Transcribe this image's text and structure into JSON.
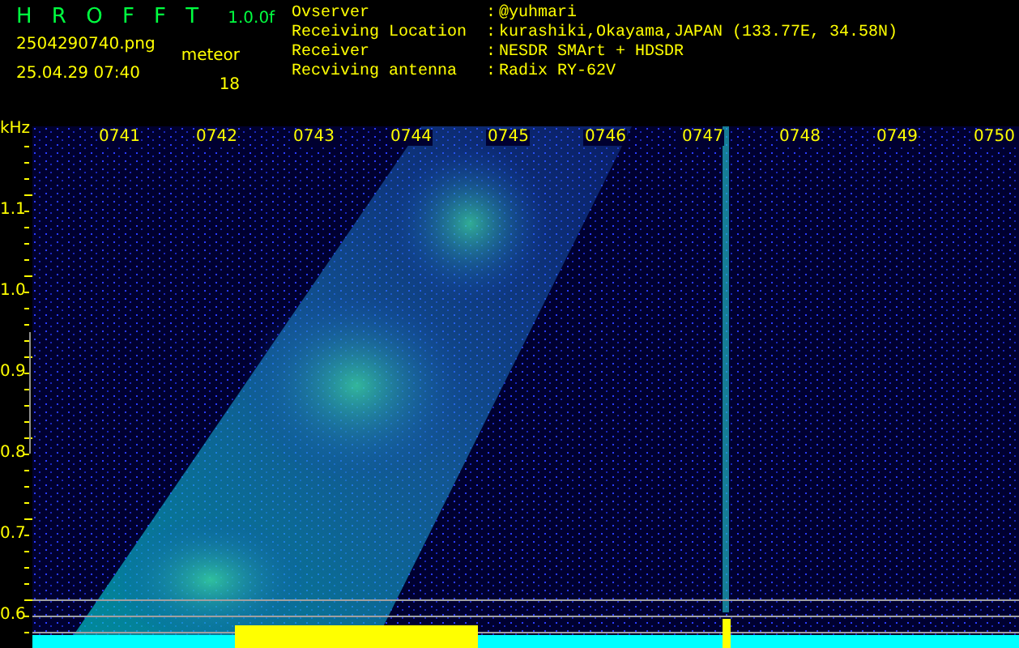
{
  "header": {
    "logo": "H R O F F T",
    "version": "1.0.0f",
    "filename": "2504290740.png",
    "datetime": "25.04.29 07:40",
    "category": "meteor",
    "count": "18"
  },
  "info": [
    {
      "label": "Ovserver",
      "separator": ":",
      "value": "@yuhmari"
    },
    {
      "label": "Receiving Location",
      "separator": ":",
      "value": "kurashiki,Okayama,JAPAN (133.77E, 34.58N)"
    },
    {
      "label": "Receiver",
      "separator": ":",
      "value": "NESDR SMArt + HDSDR"
    },
    {
      "label": "Recviving antenna",
      "separator": ":",
      "value": "Radix RY-62V"
    }
  ],
  "spectrogram": {
    "unit": "kHz",
    "y_ticks": [
      "1.1",
      "1.0",
      "0.9",
      "0.8",
      "0.7",
      "0.6"
    ],
    "x_ticks": [
      "0741",
      "0742",
      "0743",
      "0744",
      "0745",
      "0746",
      "0747",
      "0748",
      "0749",
      "0750"
    ]
  }
}
